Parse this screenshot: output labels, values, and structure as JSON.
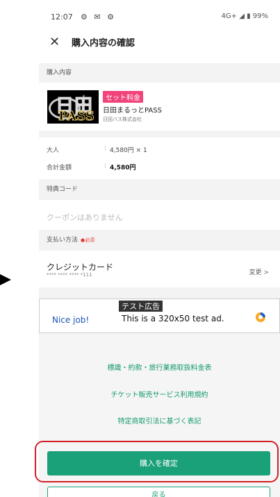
{
  "status_bar": {
    "time": "12:07",
    "icons": "⚙ ✉ ⚙",
    "right": "4G+ ◢ ▮ 99%"
  },
  "header": {
    "close_icon": "✕",
    "title": "購入内容の確認"
  },
  "purchase": {
    "section_title": "購入内容",
    "product": {
      "badge": "セット料金",
      "name": "日田まるっとPASS",
      "company": "日田バス株式会社"
    },
    "logo_text": {
      "top": "日田",
      "bottom": "PASS",
      "small": "まるっと"
    }
  },
  "price": {
    "adult_label": "大人",
    "adult_value": "4,580円 × 1",
    "total_label": "合計金額",
    "total_value": "4,580円",
    "colon": ":"
  },
  "benefit": {
    "section_title": "特典コード",
    "coupon_placeholder": "クーポンはありません"
  },
  "payment": {
    "section_title": "支払い方法",
    "required": "●必須",
    "method_name": "クレジットカード",
    "card_number": "**** **** **** *111",
    "change_label": "変更 >"
  },
  "ad": {
    "label": "テスト広告",
    "nice": "Nice job!",
    "text": "This is a 320x50 test ad.",
    "colors": {
      "orange": "#f9a825",
      "blue": "#1e63d6"
    }
  },
  "links": [
    "標識・約款・旅行業務取扱料金表",
    "チケット販売サービス利用規約",
    "特定商取引法に基づく表記"
  ],
  "buttons": {
    "confirm": "購入を確定",
    "secondary": "戻る"
  },
  "colors": {
    "accent": "#1aa179",
    "badge": "#f0447a",
    "highlight": "#d21e26"
  }
}
